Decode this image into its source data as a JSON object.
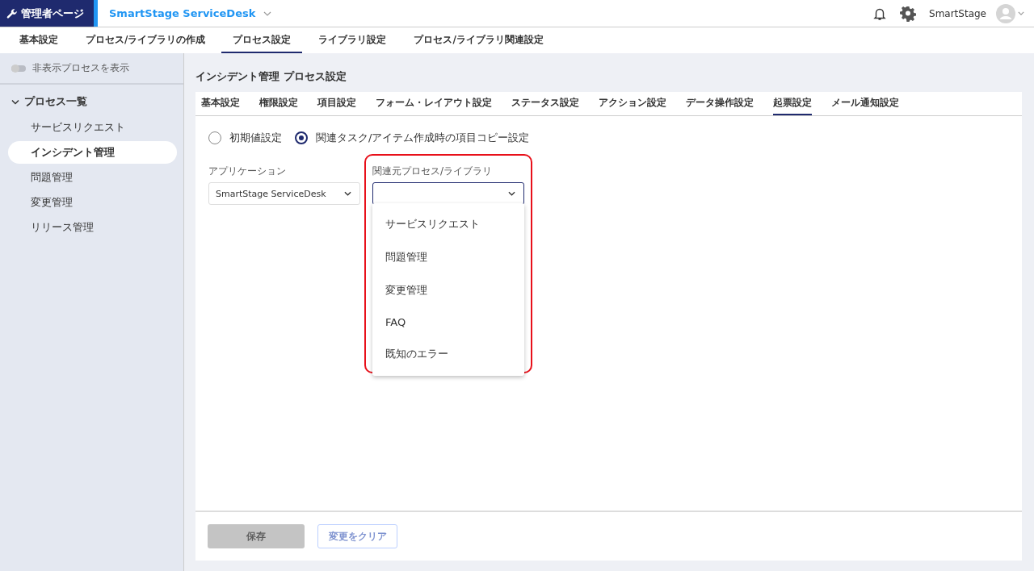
{
  "header": {
    "badge": "管理者ページ",
    "app_name": "SmartStage ServiceDesk",
    "user_name": "SmartStage"
  },
  "top_tabs": [
    {
      "label": "基本設定",
      "selected": false
    },
    {
      "label": "プロセス/ライブラリの作成",
      "selected": false
    },
    {
      "label": "プロセス設定",
      "selected": true
    },
    {
      "label": "ライブラリ設定",
      "selected": false
    },
    {
      "label": "プロセス/ライブラリ関連設定",
      "selected": false
    }
  ],
  "sidebar": {
    "toggle": {
      "label": "非表示プロセスを表示",
      "on": false
    },
    "group": {
      "label": "プロセス一覧",
      "expanded": true
    },
    "items": [
      {
        "label": "サービスリクエスト",
        "selected": false
      },
      {
        "label": "インシデント管理",
        "selected": true
      },
      {
        "label": "問題管理",
        "selected": false
      },
      {
        "label": "変更管理",
        "selected": false
      },
      {
        "label": "リリース管理",
        "selected": false
      }
    ]
  },
  "page_title": "インシデント管理 プロセス設定",
  "tabs": [
    {
      "label": "基本設定",
      "selected": false
    },
    {
      "label": "権限設定",
      "selected": false
    },
    {
      "label": "項目設定",
      "selected": false
    },
    {
      "label": "フォーム・レイアウト設定",
      "selected": false
    },
    {
      "label": "ステータス設定",
      "selected": false
    },
    {
      "label": "アクション設定",
      "selected": false
    },
    {
      "label": "データ操作設定",
      "selected": false
    },
    {
      "label": "起票設定",
      "selected": true
    },
    {
      "label": "メール通知設定",
      "selected": false
    }
  ],
  "radios": [
    {
      "label": "初期値設定",
      "selected": false
    },
    {
      "label": "関連タスク/アイテム作成時の項目コピー設定",
      "selected": true
    }
  ],
  "application": {
    "label": "アプリケーション",
    "value": "SmartStage ServiceDesk"
  },
  "source": {
    "label": "関連元プロセス/ライブラリ",
    "expanded": true,
    "highlighted": true,
    "options": [
      "サービスリクエスト",
      "問題管理",
      "変更管理",
      "FAQ",
      "既知のエラー"
    ]
  },
  "buttons": [
    {
      "label": "保存",
      "kind": "primary",
      "disabled": true
    },
    {
      "label": "変更をクリア",
      "kind": "secondary",
      "disabled": true
    }
  ]
}
